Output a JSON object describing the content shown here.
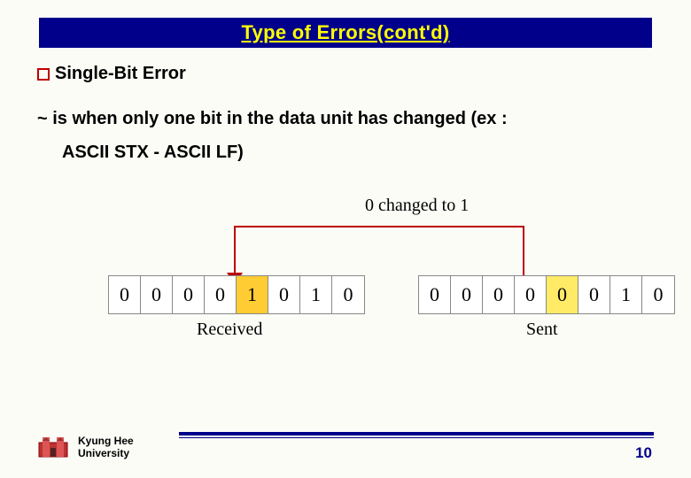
{
  "title": "Type of Errors(cont'd)",
  "subhead": "Single-Bit Error",
  "body_line1": "~ is when only one bit in the data unit has changed    (ex :",
  "body_line2": "ASCII STX - ASCII LF)",
  "diagram": {
    "top_label": "0 changed to 1",
    "received": {
      "bits": [
        "0",
        "0",
        "0",
        "0",
        "1",
        "0",
        "1",
        "0"
      ],
      "highlight_index": 4,
      "caption": "Received"
    },
    "sent": {
      "bits": [
        "0",
        "0",
        "0",
        "0",
        "0",
        "0",
        "1",
        "0"
      ],
      "highlight_index": 4,
      "caption": "Sent"
    }
  },
  "footer": {
    "uni_line1": "Kyung Hee",
    "uni_line2": "University",
    "page": "10"
  }
}
